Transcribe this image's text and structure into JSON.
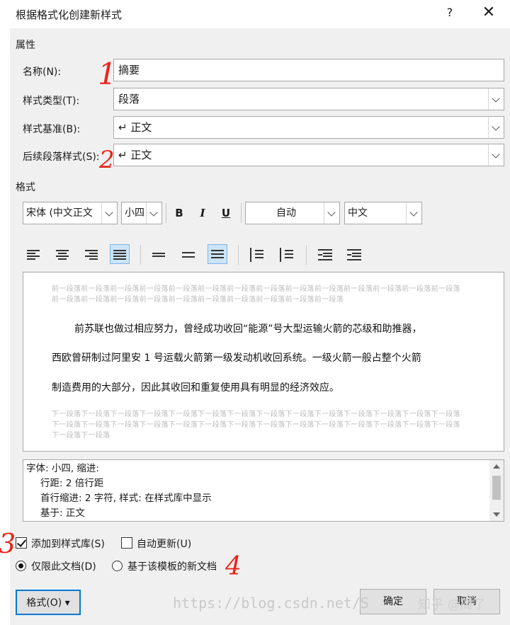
{
  "window": {
    "title": "根据格式化创建新样式",
    "help_glyph": "?",
    "close_glyph": "✕"
  },
  "properties": {
    "section_label": "属性",
    "name_label": "名称(N):",
    "name_value": "摘要",
    "style_type_label": "样式类型(T):",
    "style_type_value": "段落",
    "based_on_label": "样式基准(B):",
    "based_on_value": "↵ 正文",
    "following_label": "后续段落样式(S):",
    "following_value": "↵ 正文"
  },
  "formatting": {
    "section_label": "格式",
    "font_value": "宋体 (中文正文",
    "size_value": "小四",
    "bold": "B",
    "italic": "I",
    "underline": "U",
    "color_value": "自动",
    "language_value": "中文"
  },
  "preview": {
    "prev_paragraph": "前一段落前一段落前一段落前一段落前一段落前一段落前一段落前一段落前一段落前一段落前一段落前一段落前一段落前一段落前一段落前一段落前一段落前一段落前一段落前一段落前一段落前一段落前一段落前一段落",
    "sample_line1": "前苏联也做过相应努力，曾经成功收回“能源”号大型运输火箭的芯级和助推器，",
    "sample_line2": "西欧曾研制过阿里安 1 号运载火箭第一级发动机收回系统。一级火箭一般占整个火箭",
    "sample_line3": "制造费用的大部分，因此其收回和重复使用具有明显的经济效应。",
    "next_paragraph": "下一段落下一段落下一段落下一段落下一段落下一段落下一段落下一段落下一段落下一段落下一段落下一段落下一段落下一段落下一段落下一段落下一段落下一段落下一段落下一段落下一段落下一段落下一段落下一段落下一段落下一段落下一段落下一段落下一段落下一段落"
  },
  "description": {
    "line1": "字体: 小四, 缩进:",
    "line2": "行距: 2 倍行距",
    "line3": "首行缩进:  2 字符, 样式: 在样式库中显示",
    "line4": "基于: 正文"
  },
  "options": {
    "add_to_gallery": "添加到样式库(S)",
    "auto_update": "自动更新(U)",
    "only_this_doc": "仅限此文档(D)",
    "new_docs_template": "基于该模板的新文档"
  },
  "buttons": {
    "format": "格式(O) ▾",
    "ok": "确定",
    "cancel": "取消"
  },
  "annotations": {
    "a1": "1",
    "a2": "2",
    "a3": "3",
    "a4": "4"
  },
  "watermark": {
    "url": "https://blog.csdn.net/S",
    "logo": "知乎 @周了"
  },
  "colors": {
    "dialog_bg": "#f0f0f0",
    "selection_blue": "#cce4f7",
    "focus_blue": "#0078d7",
    "annotation_red": "#e8251c"
  }
}
